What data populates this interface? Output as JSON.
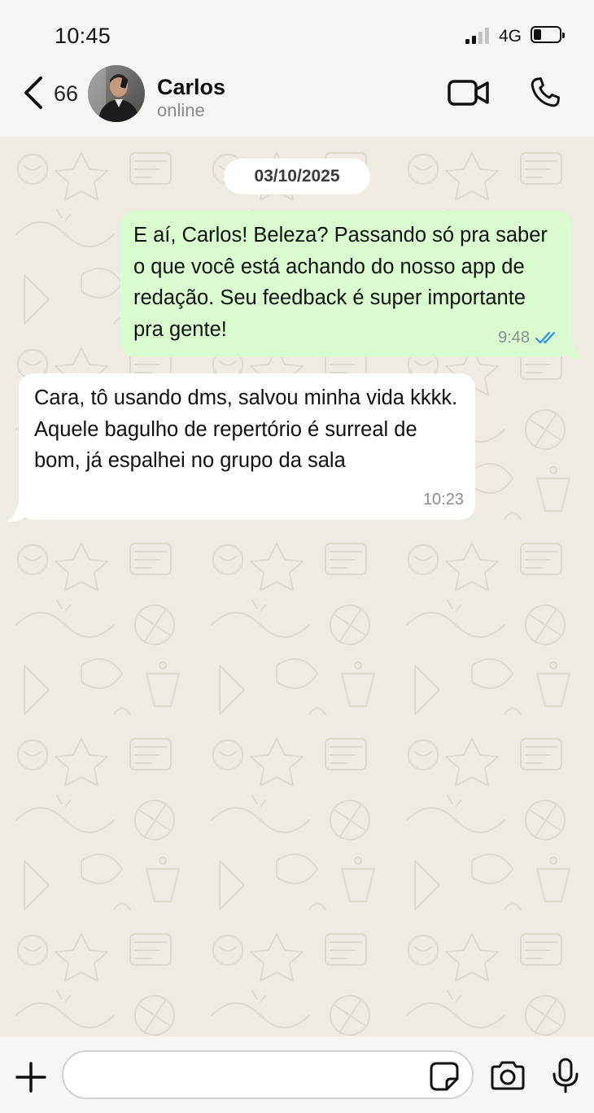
{
  "status_bar": {
    "time": "10:45",
    "network": "4G",
    "signal_bars": 2,
    "battery_level": 0.25
  },
  "header": {
    "back_count": "66",
    "contact_name": "Carlos",
    "contact_status": "online"
  },
  "chat": {
    "date_label": "03/10/2025",
    "messages": [
      {
        "direction": "outgoing",
        "text": "E aí, Carlos! Beleza? Passando só pra saber o que você está achando do nosso app de redação. Seu feedback é super importante pra gente!",
        "time": "9:48",
        "read": true
      },
      {
        "direction": "incoming",
        "text": "Cara, tô usando dms, salvou minha vida kkkk. Aquele bagulho de repertório é surreal de bom, já espalhei no grupo da sala",
        "time": "10:23"
      }
    ]
  },
  "input": {
    "placeholder": ""
  },
  "colors": {
    "outgoing_bubble": "#dafdcf",
    "incoming_bubble": "#ffffff",
    "chat_background": "#efeae2",
    "read_ticks": "#2b8ef0"
  },
  "icons": [
    "back-chevron-icon",
    "video-call-icon",
    "phone-icon",
    "plus-icon",
    "sticker-icon",
    "camera-icon",
    "microphone-icon",
    "double-check-icon"
  ]
}
